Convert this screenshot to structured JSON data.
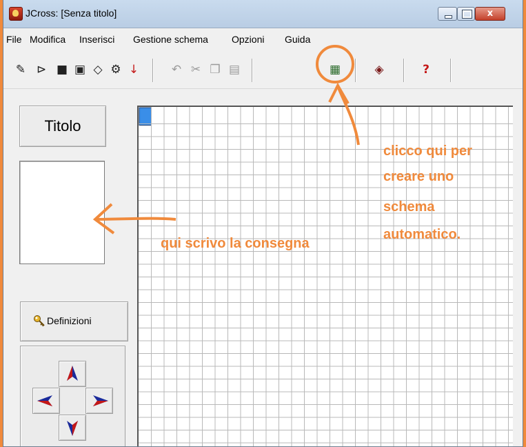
{
  "window": {
    "title": "JCross: [Senza titolo]",
    "close_label": "x"
  },
  "menu": {
    "items": [
      {
        "label": "File",
        "name": "menu-file"
      },
      {
        "label": "Modifica",
        "name": "menu-modifica"
      },
      {
        "label": "Inserisci",
        "name": "menu-inserisci"
      },
      {
        "label": "Gestione schema",
        "name": "menu-gestione-schema"
      },
      {
        "label": "Opzioni",
        "name": "menu-opzioni"
      },
      {
        "label": "Guida",
        "name": "menu-guida"
      }
    ]
  },
  "toolbar": {
    "tools": [
      {
        "icon": "new-file-icon",
        "glyph": "✎",
        "enabled": true
      },
      {
        "icon": "open-folder-icon",
        "glyph": "⊳",
        "enabled": true
      },
      {
        "icon": "save-icon",
        "glyph": "■",
        "enabled": true
      },
      {
        "icon": "save-as-icon",
        "glyph": "▣",
        "enabled": true
      },
      {
        "icon": "erase-icon",
        "glyph": "◇",
        "enabled": true
      },
      {
        "icon": "web-export-icon",
        "glyph": "⚙",
        "enabled": true
      },
      {
        "icon": "down-arrow-icon",
        "glyph": "↓",
        "enabled": true
      },
      {
        "icon": "undo-icon",
        "glyph": "↶",
        "enabled": false
      },
      {
        "icon": "cut-icon",
        "glyph": "✂",
        "enabled": false
      },
      {
        "icon": "copy-icon",
        "glyph": "❐",
        "enabled": false
      },
      {
        "icon": "paste-icon",
        "glyph": "▤",
        "enabled": false
      },
      {
        "icon": "auto-grid-icon",
        "glyph": "▦",
        "enabled": true
      },
      {
        "icon": "preview-icon",
        "glyph": "◈",
        "enabled": true
      },
      {
        "icon": "help-icon",
        "glyph": "?",
        "enabled": true
      }
    ]
  },
  "left_panel": {
    "title_button": "Titolo",
    "definitions_button": "Definizioni"
  },
  "annotations": {
    "left_note": "qui scrivo la consegna",
    "right_note_lines": [
      "clicco qui per",
      "creare uno",
      "schema",
      "automatico."
    ]
  },
  "colors": {
    "accent": "#f08a3c",
    "selected_cell": "#3a8ee8",
    "arrow_blue": "#1b2a9a",
    "arrow_red": "#c41818"
  }
}
